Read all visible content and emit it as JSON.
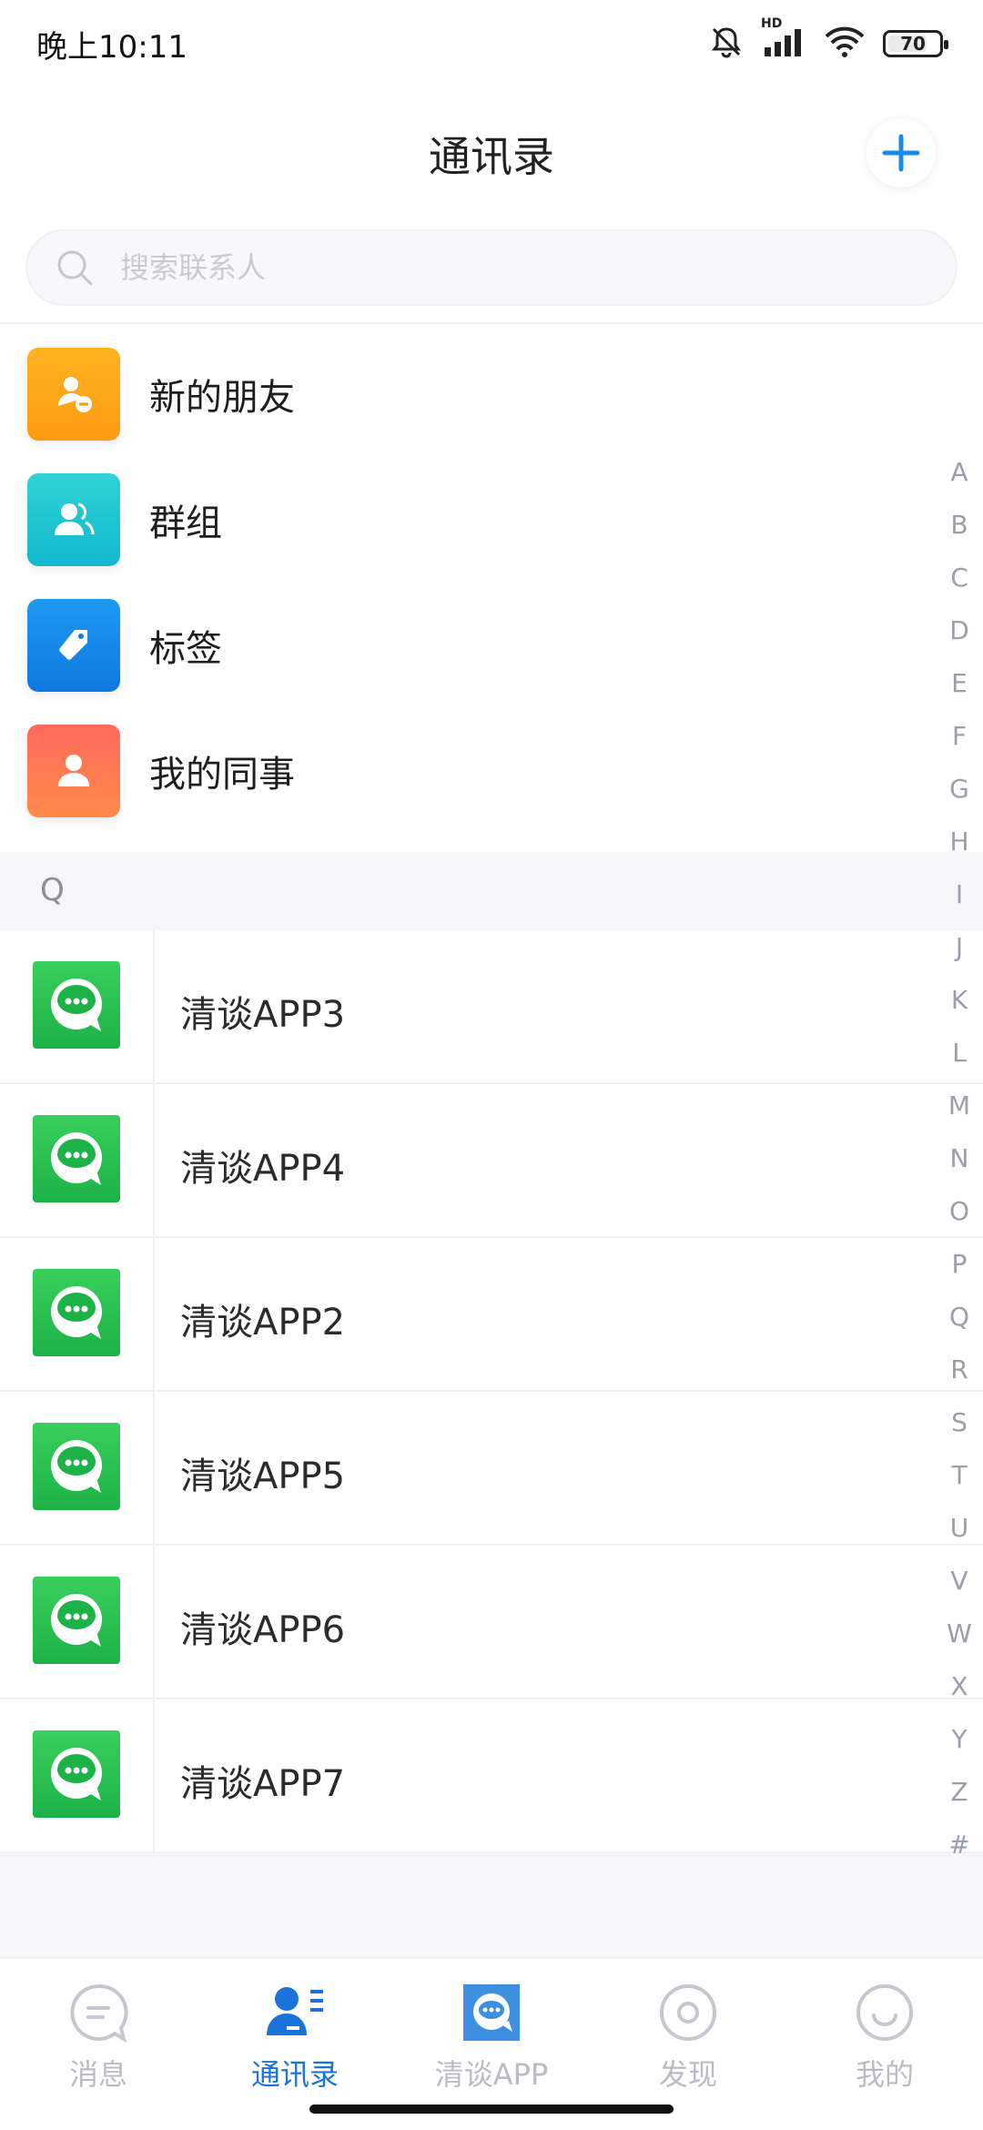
{
  "status_bar": {
    "time": "晚上10:11",
    "hd_label": "HD",
    "battery": "70"
  },
  "header": {
    "title": "通讯录",
    "add_icon": "plus-icon"
  },
  "search": {
    "placeholder": "搜索联系人",
    "value": ""
  },
  "features": [
    {
      "label": "新的朋友",
      "icon": "new-friend-icon",
      "color_from": "#ffb31f",
      "color_to": "#ff9a12"
    },
    {
      "label": "群组",
      "icon": "group-icon",
      "color_from": "#2fd3d3",
      "color_to": "#12b7cf"
    },
    {
      "label": "标签",
      "icon": "tag-icon",
      "color_from": "#1d9af2",
      "color_to": "#1178e0"
    },
    {
      "label": "我的同事",
      "icon": "colleague-icon",
      "color_from": "#ff6a5c",
      "color_to": "#ff8a4a"
    }
  ],
  "section": {
    "letter": "Q"
  },
  "contacts": [
    {
      "name": "清谈APP3"
    },
    {
      "name": "清谈APP4"
    },
    {
      "name": "清谈APP2"
    },
    {
      "name": "清谈APP5"
    },
    {
      "name": "清谈APP6"
    },
    {
      "name": "清谈APP7"
    }
  ],
  "alphabet": [
    "A",
    "B",
    "C",
    "D",
    "E",
    "F",
    "G",
    "H",
    "I",
    "J",
    "K",
    "L",
    "M",
    "N",
    "O",
    "P",
    "Q",
    "R",
    "S",
    "T",
    "U",
    "V",
    "W",
    "X",
    "Y",
    "Z",
    "#"
  ],
  "tabs": [
    {
      "label": "消息",
      "icon": "message-icon",
      "active": false
    },
    {
      "label": "通讯录",
      "icon": "contacts-icon",
      "active": true
    },
    {
      "label": "清谈APP",
      "icon": "app-icon",
      "active": false
    },
    {
      "label": "发现",
      "icon": "discover-icon",
      "active": false
    },
    {
      "label": "我的",
      "icon": "profile-icon",
      "active": false
    }
  ],
  "colors": {
    "accent": "#1a73d9",
    "contact_green": "#1cb248",
    "inactive": "#b8bcc3"
  }
}
